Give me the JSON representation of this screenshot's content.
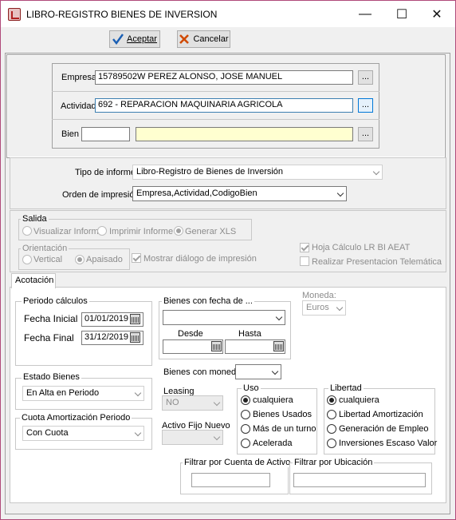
{
  "window": {
    "title": "LIBRO-REGISTRO BIENES DE INVERSION",
    "minimize": "—",
    "maximize": "☐",
    "close": "✕"
  },
  "toolbar": {
    "accept_label": "Aceptar",
    "cancel_label": "Cancelar"
  },
  "empresa": {
    "label": "Empresa",
    "value": "15789502W PEREZ ALONSO, JOSE MANUEL",
    "browse": "..."
  },
  "actividad": {
    "label": "Actividad",
    "value": "692 - REPARACION MAQUINARIA AGRICOLA",
    "browse": "..."
  },
  "bien": {
    "label": "Bien",
    "code": "",
    "description": "",
    "browse": "..."
  },
  "informe": {
    "label": "Tipo de informe:",
    "value": "Libro-Registro de Bienes de Inversión"
  },
  "orden": {
    "label": "Orden de impresión:",
    "value": "Empresa,Actividad,CodigoBien"
  },
  "salida": {
    "title": "Salida",
    "options": [
      "Visualizar Informe",
      "Imprimir Informe",
      "Generar XLS"
    ],
    "selected": "Generar XLS"
  },
  "orientacion": {
    "title": "Orientación",
    "options": [
      "Vertical",
      "Apaisado"
    ],
    "selected": "Apaisado"
  },
  "mostrar_dialogo": {
    "label": "Mostrar diálogo de impresión",
    "checked": true
  },
  "hoja_calculo": {
    "label": "Hoja Cálculo LR BI AEAT",
    "checked": true
  },
  "presentacion": {
    "label": "Realizar Presentacion Telemática",
    "checked": false
  },
  "tab": {
    "label": "Acotación"
  },
  "periodo": {
    "title": "Periodo cálculos",
    "inicial_label": "Fecha Inicial",
    "inicial_value": "01/01/2019",
    "final_label": "Fecha Final",
    "final_value": "31/12/2019"
  },
  "estado": {
    "title": "Estado Bienes",
    "value": "En Alta en Periodo"
  },
  "cuota": {
    "title": "Cuota Amortización Periodo",
    "value": "Con Cuota"
  },
  "bienes_fecha": {
    "title": "Bienes con fecha de ...",
    "value": "",
    "desde_label": "Desde",
    "desde_value": "",
    "hasta_label": "Hasta",
    "hasta_value": ""
  },
  "moneda": {
    "label": "Moneda:",
    "value": "Euros"
  },
  "bienes_moneda": {
    "label": "Bienes con moneda:",
    "value": ""
  },
  "leasing": {
    "label": "Leasing",
    "value": "NO"
  },
  "activo_fijo": {
    "label": "Activo Fijo Nuevo",
    "value": ""
  },
  "uso": {
    "title": "Uso",
    "options": [
      "cualquiera",
      "Bienes Usados",
      "Más de un turno",
      "Acelerada"
    ],
    "selected": "cualquiera"
  },
  "libertad": {
    "title": "Libertad",
    "options": [
      "cualquiera",
      "Libertad Amortización",
      "Generación de Empleo",
      "Inversiones Escaso Valor"
    ],
    "selected": "cualquiera"
  },
  "filtro_cuenta": {
    "label": "Filtrar por Cuenta de Activo",
    "value": ""
  },
  "filtro_ubicacion": {
    "label": "Filtrar por Ubicación",
    "value": ""
  }
}
